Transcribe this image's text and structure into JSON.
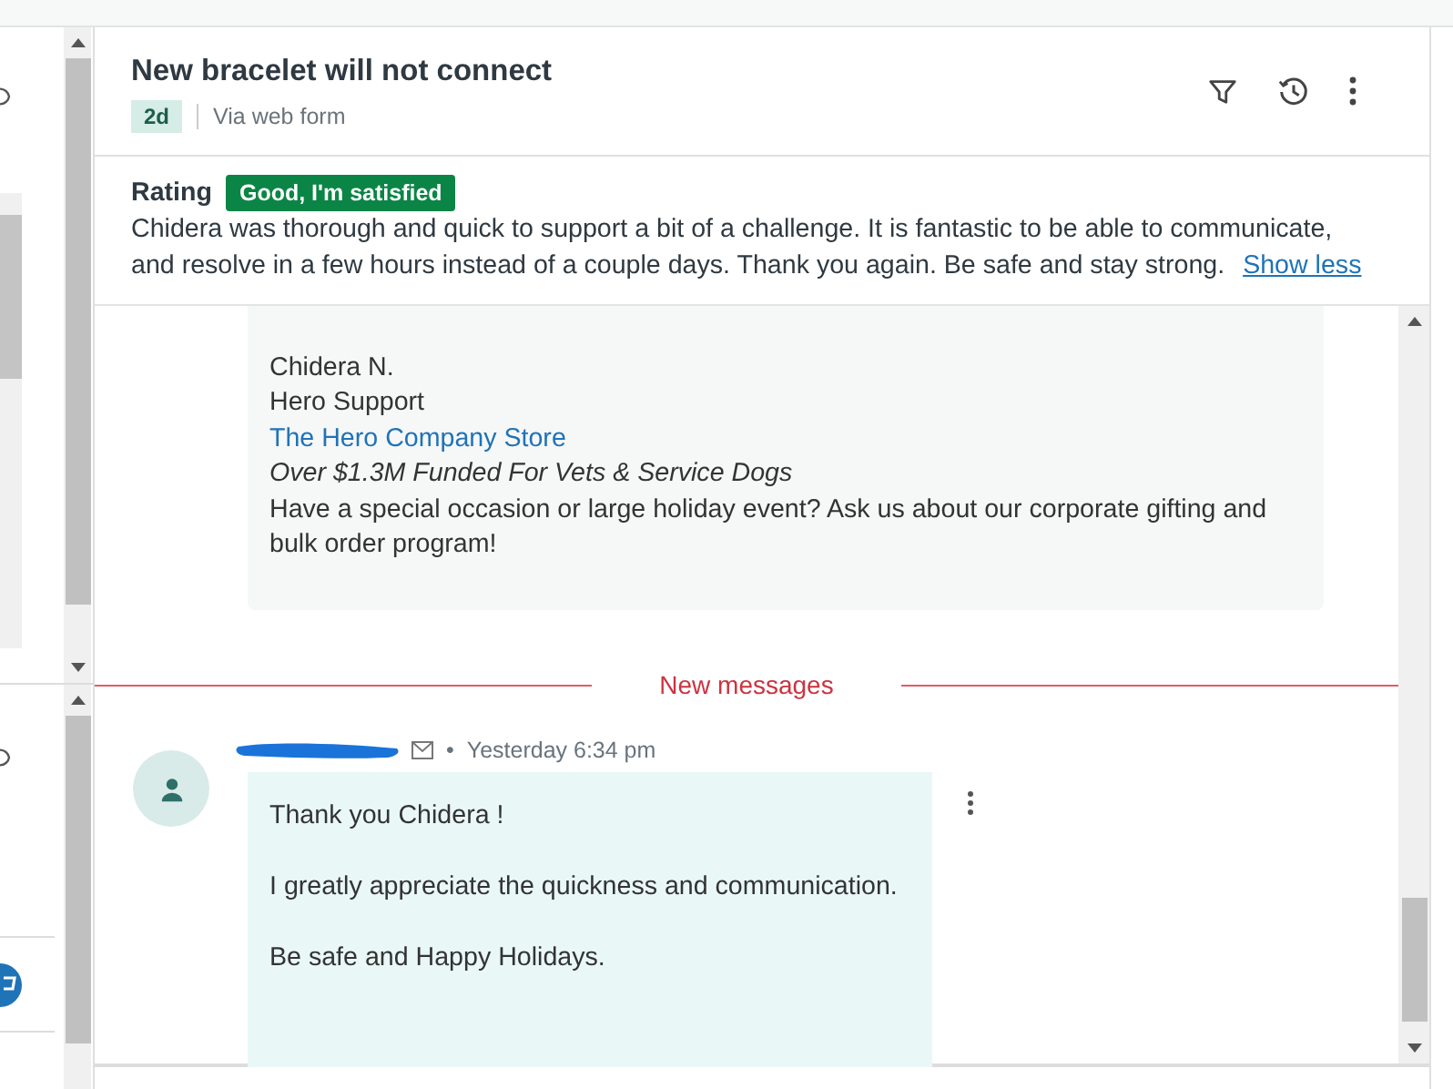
{
  "ticket": {
    "title": "New bracelet will not connect",
    "age": "2d",
    "channel": "Via web form"
  },
  "rating": {
    "label": "Rating",
    "value": "Good, I'm satisfied",
    "comment": "Chidera was thorough and quick to support a bit of a challenge. It is fantastic to be able to communicate, and resolve in a few hours instead of a couple days. Thank you again. Be safe and stay strong.",
    "toggle": "Show less"
  },
  "signature": [
    {
      "kind": "plain",
      "text": "Chidera N."
    },
    {
      "kind": "plain",
      "text": "Hero Support"
    },
    {
      "kind": "link",
      "text": "The Hero Company Store"
    },
    {
      "kind": "italic",
      "text": "Over $1.3M Funded For Vets & Service Dogs"
    },
    {
      "kind": "plain",
      "text": "Have a special occasion or large holiday event? Ask us about our corporate gifting and bulk order program!"
    }
  ],
  "divider": "New messages",
  "reply": {
    "separator": "•",
    "time": "Yesterday 6:34 pm",
    "paragraphs": [
      "Thank you Chidera !",
      "I greatly appreciate the quickness and communication.",
      "Be safe and Happy Holidays."
    ]
  }
}
